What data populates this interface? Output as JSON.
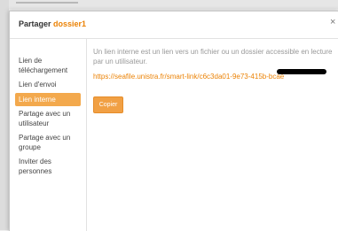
{
  "dialog": {
    "title_prefix": "Partager",
    "item_name": "dossier1",
    "close_label": "×"
  },
  "sidebar": {
    "items": [
      {
        "label": "Lien de téléchargement",
        "active": false
      },
      {
        "label": "Lien d'envoi",
        "active": false
      },
      {
        "label": "Lien interne",
        "active": true
      },
      {
        "label": "Partage avec un utilisateur",
        "active": false
      },
      {
        "label": "Partage avec un groupe",
        "active": false
      },
      {
        "label": "Inviter des personnes",
        "active": false
      }
    ]
  },
  "content": {
    "description": "Un lien interne est un lien vers un fichier ou un dossier accessible en lecture par un utilisateur.",
    "link": "https://seafile.unistra.fr/smart-link/c6c3da01-9e73-415b-bcae",
    "copy_label": "Copier"
  },
  "colors": {
    "accent": "#eb8205",
    "active_nav": "#f3a94d",
    "button": "#f1a044"
  }
}
